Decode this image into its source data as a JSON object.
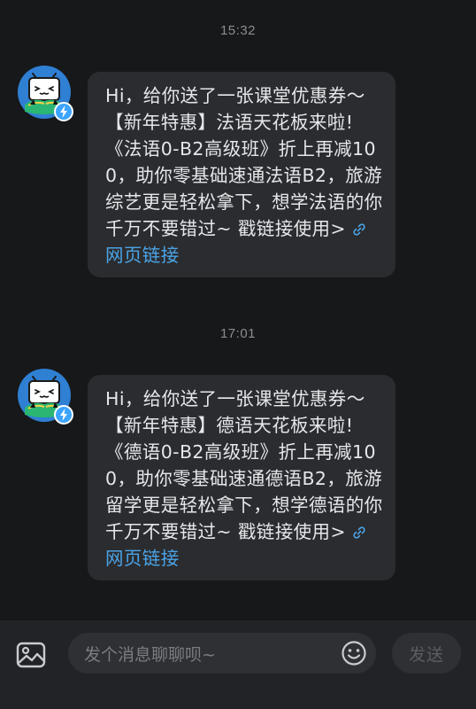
{
  "messages": [
    {
      "time": "15:32",
      "text": "Hi，给你送了一张课堂优惠券～【新年特惠】法语天花板来啦!《法语0-B2高级班》折上再减100，助你零基础速通法语B2，旅游综艺更是轻松拿下，想学法语的你千万不要错过~ 戳链接使用> ",
      "link_label": "网页链接"
    },
    {
      "time": "17:01",
      "text": "Hi，给你送了一张课堂优惠券～【新年特惠】德语天花板来啦!《德语0-B2高级班》折上再减100，助你零基础速通德语B2，旅游留学更是轻松拿下，想学德语的你千万不要错过~ 戳链接使用> ",
      "link_label": "网页链接"
    }
  ],
  "composer": {
    "placeholder": "发个消息聊聊呗~",
    "send_label": "发送",
    "image_icon": "image-icon",
    "emoji_icon": "emoji-icon"
  },
  "colors": {
    "background": "#17181a",
    "bubble": "#2b2c2f",
    "link": "#4aa3e6",
    "avatar_bg": "#2f7fd3",
    "badge": "#3da4ff"
  }
}
